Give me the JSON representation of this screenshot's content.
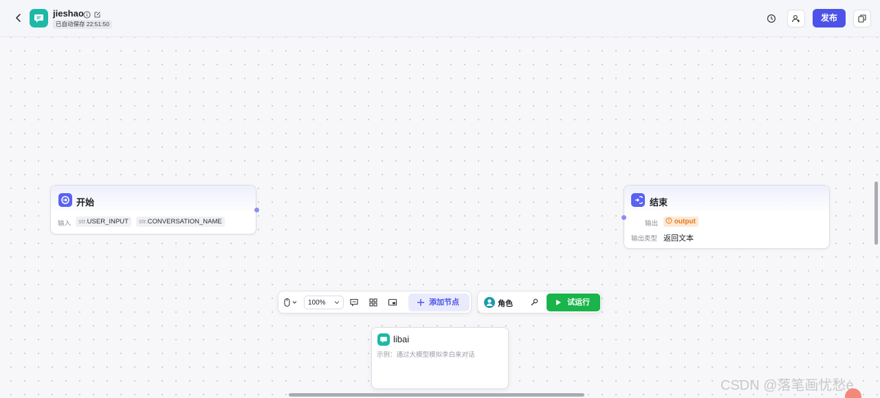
{
  "header": {
    "app_name": "jieshao",
    "save_status": "已自动保存 22:51:50",
    "publish_label": "发布",
    "icons": [
      "back-arrow-icon",
      "app-chat-icon",
      "info-icon",
      "edit-icon",
      "history-icon",
      "collaborators-icon",
      "duplicate-icon"
    ]
  },
  "start_node": {
    "title": "开始",
    "input_label": "输入",
    "params": [
      {
        "type": "str.",
        "name": "USER_INPUT"
      },
      {
        "type": "str.",
        "name": "CONVERSATION_NAME"
      }
    ]
  },
  "end_node": {
    "title": "结束",
    "output_label": "输出",
    "output_value": "output",
    "output_type_label": "输出类型",
    "output_type_value": "返回文本"
  },
  "toolbar": {
    "zoom": "100%",
    "add_node_label": "添加节点",
    "role_label": "角色",
    "run_label": "试运行"
  },
  "bot_card": {
    "title": "libai",
    "description": "示例：通过大模型模拟李白来对话"
  },
  "watermark": "CSDN @落笔画忧愁e",
  "colors": {
    "accent": "#4d53e8",
    "run_green": "#19b44a",
    "app_teal": "#1db8a6",
    "output_orange": "#e3781c"
  }
}
